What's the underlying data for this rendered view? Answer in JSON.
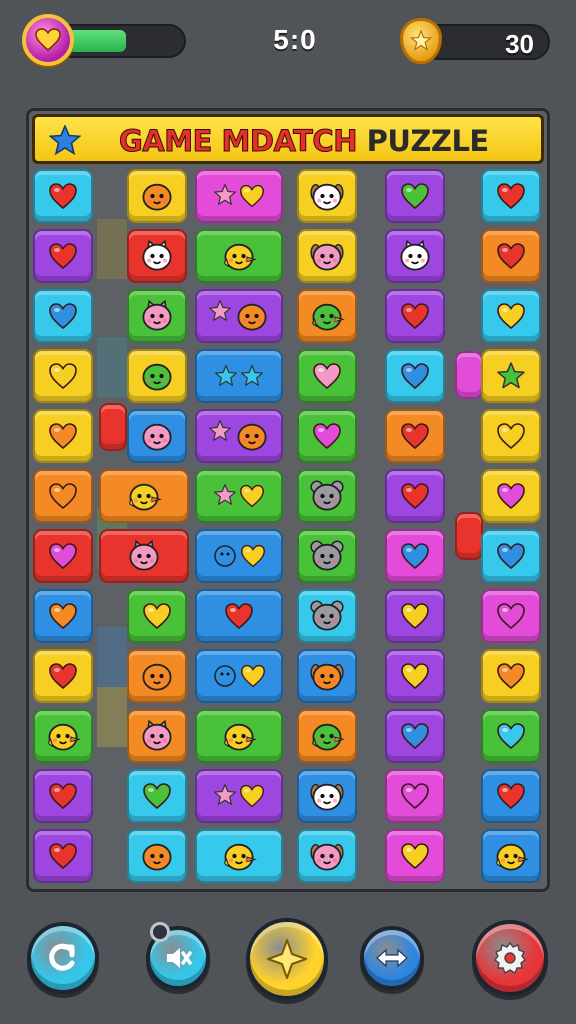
{
  "hud": {
    "timer": "5:0",
    "score": "30",
    "life_level": 0.55,
    "life_icon": "heart-icon",
    "score_icon": "star-badge-icon"
  },
  "title": {
    "part1": "GAME MDATCH",
    "part2": "PUZZLE"
  },
  "colors": {
    "red": "#f04a3e",
    "orange": "#f7932b",
    "yellow": "#f9d92c",
    "green": "#5fc84a",
    "cyan": "#2cc7e8",
    "blue": "#2f9de8",
    "purple": "#a54ee6",
    "magenta": "#e64be0",
    "pink": "#f06aa8"
  },
  "board": {
    "rows": [
      [
        "cyan:heart-red",
        "yellow:blob-orange",
        "magenta:star+heart",
        "yellow:dog-white",
        "purple:heart-green",
        "cyan:heart-red"
      ],
      [
        "purple:heart-red",
        "red:cat-white",
        "green:bird-yellow",
        "yellow:dog-pink",
        "purple:cat-white",
        "orange:heart-red"
      ],
      [
        "cyan:heart-blue",
        "green:cat-pink",
        "purple:star+blob",
        "orange:bird-green",
        "purple:heart-red",
        "cyan:heart-yellow"
      ],
      [
        "yellow:heart-yellow",
        "yellow:blob-green",
        "blue:star+star",
        "green:heart-pink",
        "cyan:heart-blue",
        "yellow:star-green"
      ],
      [
        "yellow:heart-orange",
        "blue:blob-pink",
        "purple:star+blob",
        "green:heart-magenta",
        "orange:heart-red",
        "yellow:heart-yellow"
      ],
      [
        "orange:heart-orange",
        "orange:bird-yellow",
        "green:star+heart",
        "green:mouse-grey",
        "purple:heart-red",
        "yellow:heart-magenta"
      ],
      [
        "red:heart-magenta",
        "red:cat-pink",
        "blue:dot+heart",
        "green:mouse-grey",
        "magenta:heart-blue",
        "cyan:heart-blue"
      ],
      [
        "blue:heart-orange",
        "green:heart-yellow",
        "blue:heart-red",
        "cyan:mouse-grey",
        "purple:heart-yellow",
        "magenta:heart-magenta"
      ],
      [
        "yellow:heart-red",
        "orange:blob-orange",
        "blue:dot+heart",
        "blue:dog-orange",
        "purple:heart-yellow",
        "yellow:heart-orange"
      ],
      [
        "green:bird-yellow",
        "orange:cat-pink",
        "green:bird-yellow",
        "orange:bird-green",
        "purple:heart-blue",
        "green:heart-cyan"
      ],
      [
        "purple:heart-red",
        "cyan:heart-green",
        "purple:star+heart",
        "blue:dog-white",
        "magenta:heart-magenta",
        "blue:heart-red"
      ],
      [
        "purple:heart-red",
        "cyan:blob-orange",
        "cyan:bird-yellow",
        "cyan:dog-pink",
        "magenta:heart-yellow",
        "blue:bird-yellow"
      ]
    ]
  },
  "buttons": [
    {
      "name": "undo-button",
      "icon": "undo-arrow-icon",
      "color": "#35c6ea"
    },
    {
      "name": "mute-button",
      "icon": "mute-icon",
      "color": "#35c6ea"
    },
    {
      "name": "hint-button",
      "icon": "sparkle-icon",
      "color": "#ffd22c"
    },
    {
      "name": "swap-button",
      "icon": "swap-arrows-icon",
      "color": "#2f86e0"
    },
    {
      "name": "settings-button",
      "icon": "gear-icon",
      "color": "#e8353a"
    }
  ]
}
